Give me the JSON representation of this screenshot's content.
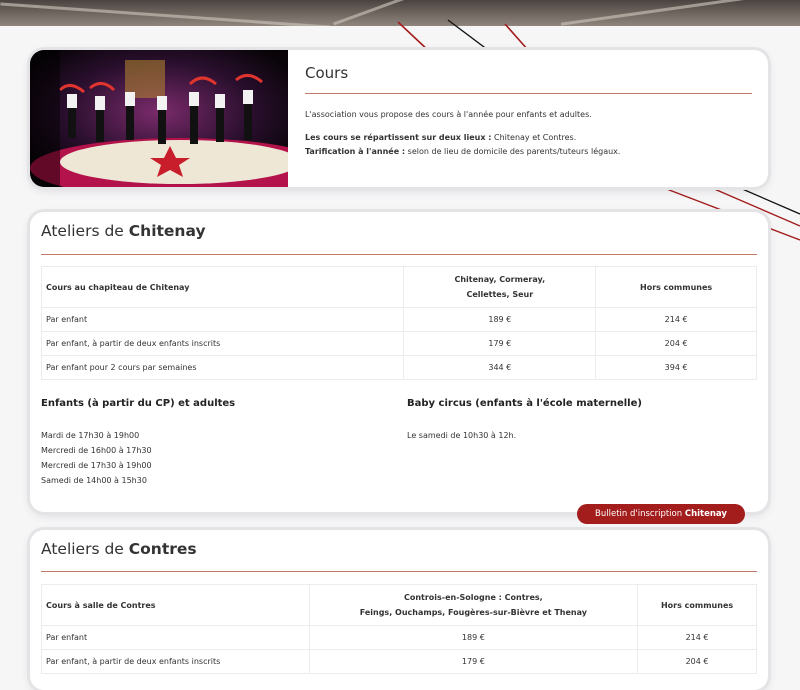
{
  "cours": {
    "title": "Cours",
    "intro": "L'association vous propose des cours à l'année pour enfants et adultes.",
    "lieux_label": "Les cours se répartissent sur deux lieux :",
    "lieux_value": "Chitenay et Contres.",
    "tarif_label": "Tarification à l'année :",
    "tarif_value": "selon de lieu de domicile des parents/tuteurs légaux."
  },
  "chitenay": {
    "title_prefix": "Ateliers de",
    "title_place": "Chitenay",
    "table": {
      "col1": "Cours au chapiteau de Chitenay",
      "col2_line1": "Chitenay, Cormeray,",
      "col2_line2": "Cellettes, Seur",
      "col3": "Hors communes",
      "rows": [
        {
          "label": "Par enfant",
          "local": "189 €",
          "hors": "214 €"
        },
        {
          "label": "Par enfant, à partir de deux enfants inscrits",
          "local": "179 €",
          "hors": "204 €"
        },
        {
          "label": "Par enfant pour 2 cours par semaines",
          "local": "344 €",
          "hors": "394 €"
        }
      ]
    },
    "enfants_title": "Enfants (à partir du CP) et adultes",
    "enfants_schedule": [
      "Mardi de 17h30 à 19h00",
      "Mercredi de 16h00 à 17h30",
      "Mercredi de 17h30 à 19h00",
      "Samedi de 14h00 à 15h30"
    ],
    "baby_title": "Baby circus (enfants à l'école maternelle)",
    "baby_schedule": [
      "Le samedi de 10h30 à 12h."
    ],
    "button_prefix": "Bulletin d'inscription",
    "button_place": "Chitenay"
  },
  "contres": {
    "title_prefix": "Ateliers de",
    "title_place": "Contres",
    "table": {
      "col1": "Cours à salle de Contres",
      "col2_line1": "Controis-en-Sologne : Contres,",
      "col2_line2": "Feings, Ouchamps, Fougères-sur-Bièvre et Thenay",
      "col3": "Hors communes",
      "rows": [
        {
          "label": "Par enfant",
          "local": "189 €",
          "hors": "214 €"
        },
        {
          "label": "Par enfant, à partir de deux enfants inscrits",
          "local": "179 €",
          "hors": "204 €"
        }
      ]
    }
  },
  "colors": {
    "accent": "#a31d1d",
    "rule": "#c07a6a",
    "page_bg": "#f6f6f7"
  }
}
